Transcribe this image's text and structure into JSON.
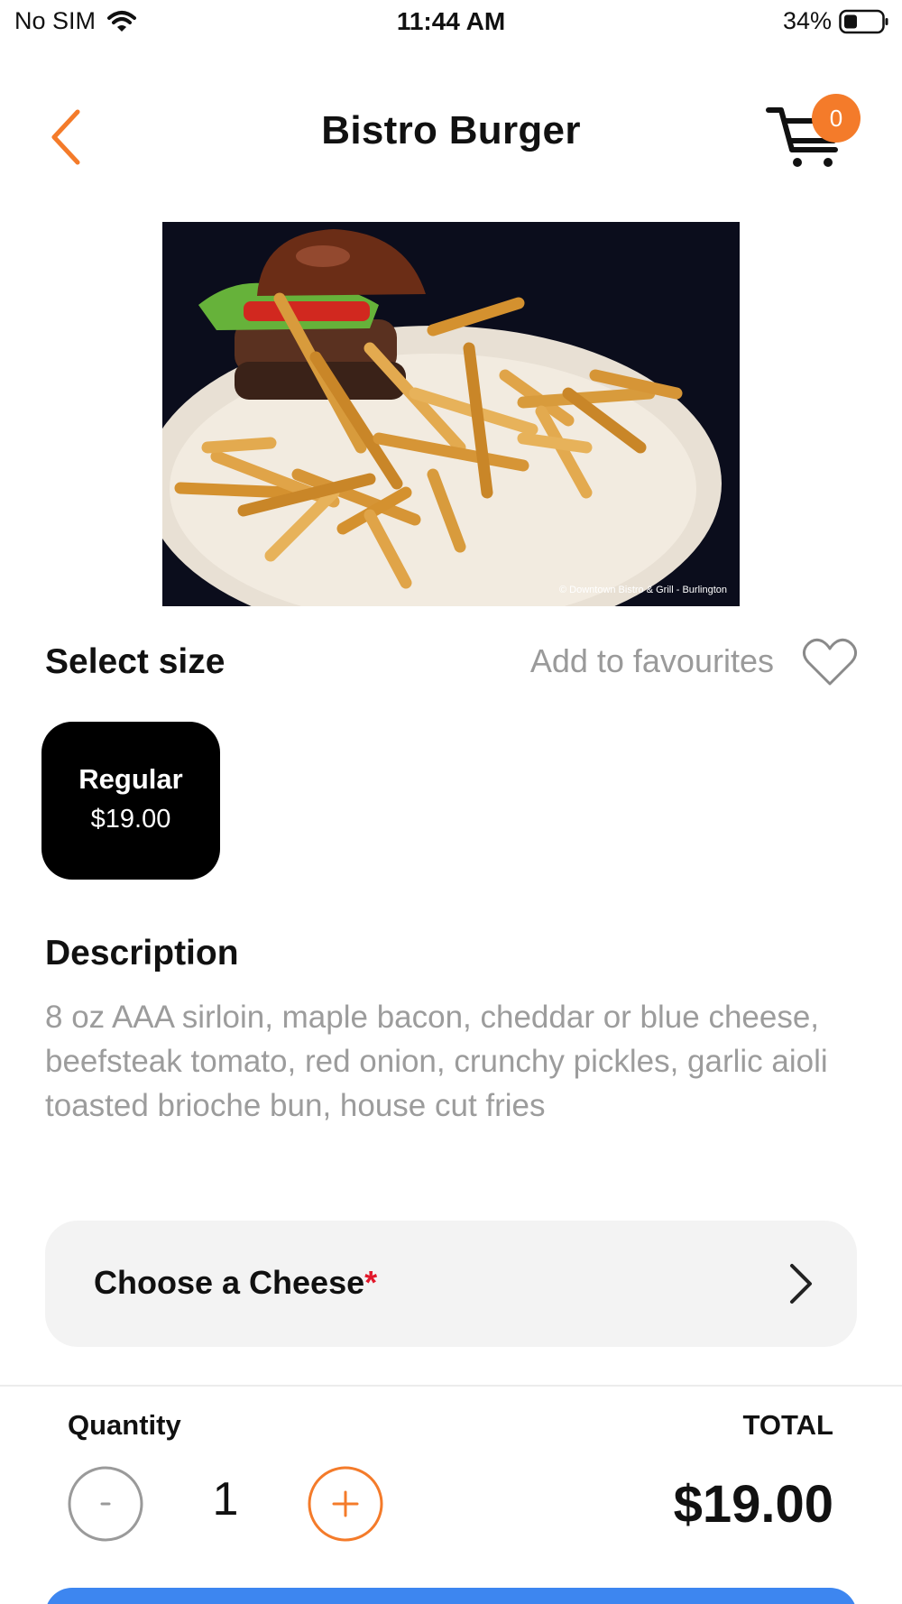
{
  "status_bar": {
    "carrier": "No SIM",
    "time": "11:44 AM",
    "battery": "34%"
  },
  "nav": {
    "title": "Bistro Burger",
    "cart_count": "0"
  },
  "hero": {
    "credit": "© Downtown Bistro & Grill - Burlington"
  },
  "size": {
    "heading": "Select size",
    "favourites_label": "Add to favourites",
    "options": [
      {
        "name": "Regular",
        "price": "$19.00",
        "selected": true
      }
    ]
  },
  "description": {
    "heading": "Description",
    "text": "8 oz AAA sirloin, maple bacon, cheddar or blue cheese, beefsteak tomato, red onion, crunchy pickles, garlic aioli toasted brioche bun, house cut fries"
  },
  "options": {
    "cheese_label": "Choose a Cheese",
    "required_mark": "*"
  },
  "order": {
    "quantity_label": "Quantity",
    "quantity": "1",
    "total_label": "TOTAL",
    "total": "$19.00"
  },
  "colors": {
    "accent": "#f47b2a",
    "primary": "#3d86f0",
    "required": "#e2182b"
  }
}
